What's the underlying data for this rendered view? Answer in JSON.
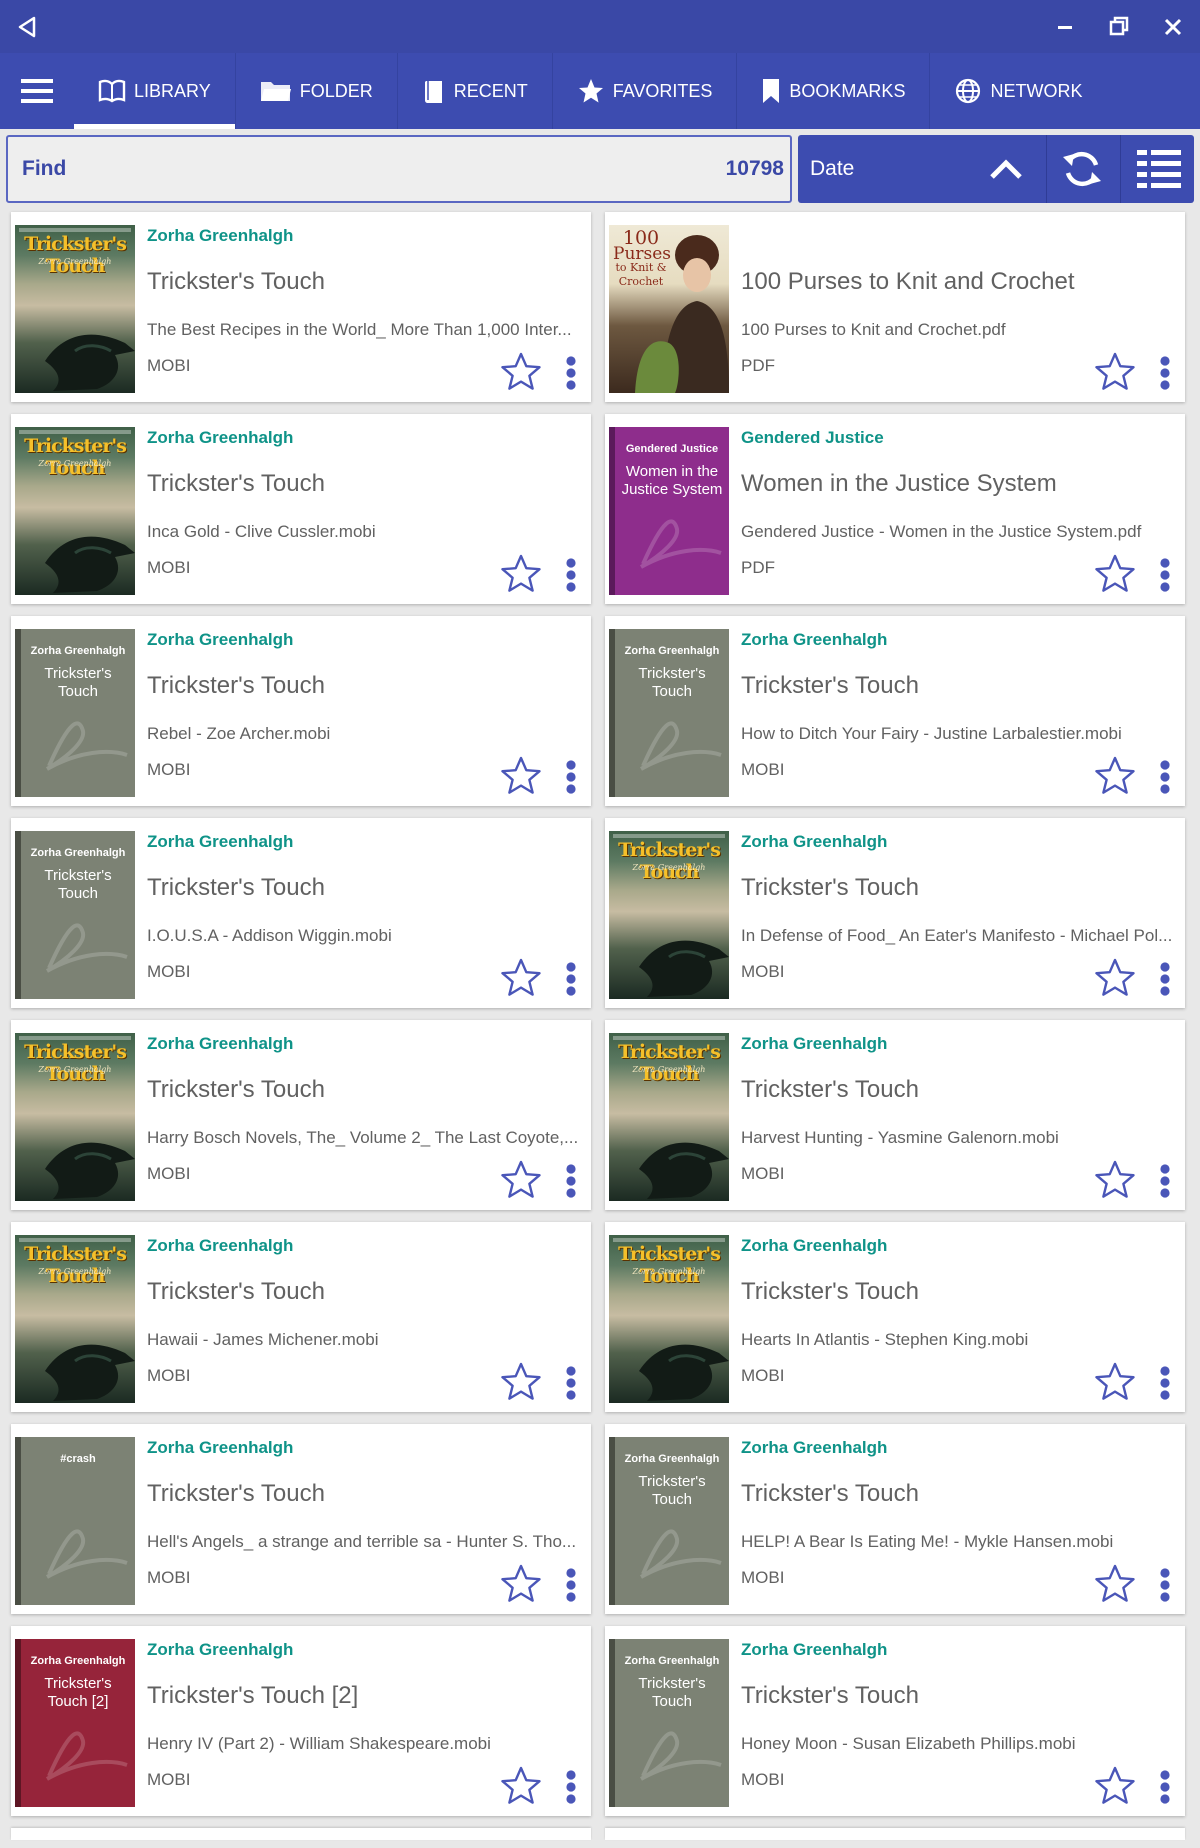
{
  "nav": {
    "tabs": [
      {
        "label": "LIBRARY",
        "icon": "book-icon",
        "active": true
      },
      {
        "label": "FOLDER",
        "icon": "folder-icon"
      },
      {
        "label": "RECENT",
        "icon": "recent-icon"
      },
      {
        "label": "FAVORITES",
        "icon": "star-icon"
      },
      {
        "label": "BOOKMARKS",
        "icon": "bookmark-icon"
      },
      {
        "label": "NETWORK",
        "icon": "globe-icon"
      }
    ]
  },
  "toolbar": {
    "find_label": "Find",
    "count": "10798",
    "sort_label": "Date"
  },
  "colors": {
    "bar": "#3a48a6",
    "accent_text": "#0f9388",
    "icon": "#4a56b8"
  },
  "books": [
    {
      "author": "Zorha Greenhalgh",
      "title": "Trickster's Touch",
      "file": "The Best Recipes in the World_ More Than 1,000 Inter...",
      "format": "MOBI",
      "cover": "trick"
    },
    {
      "author": "",
      "title": "100 Purses to Knit and Crochet",
      "file": "100 Purses to Knit and Crochet.pdf",
      "format": "PDF",
      "cover": "photo",
      "cover_lines": [
        "100",
        "Purses",
        "to Knit &",
        "Crochet"
      ]
    },
    {
      "author": "Zorha Greenhalgh",
      "title": "Trickster's Touch",
      "file": "Inca Gold - Clive Cussler.mobi",
      "format": "MOBI",
      "cover": "trick"
    },
    {
      "author": "Gendered Justice",
      "title": "Women in the Justice System",
      "file": "Gendered Justice - Women in the Justice System.pdf",
      "format": "PDF",
      "cover": "purple",
      "cover_top": "Gendered Justice",
      "cover_mid": "Women in the Justice System"
    },
    {
      "author": "Zorha Greenhalgh",
      "title": "Trickster's Touch",
      "file": "Rebel - Zoe Archer.mobi",
      "format": "MOBI",
      "cover": "grey",
      "cover_top": "Zorha Greenhalgh",
      "cover_mid": "Trickster's Touch"
    },
    {
      "author": "Zorha Greenhalgh",
      "title": "Trickster's Touch",
      "file": "How to Ditch Your Fairy - Justine Larbalestier.mobi",
      "format": "MOBI",
      "cover": "grey",
      "cover_top": "Zorha Greenhalgh",
      "cover_mid": "Trickster's Touch"
    },
    {
      "author": "Zorha Greenhalgh",
      "title": "Trickster's Touch",
      "file": "I.O.U.S.A - Addison Wiggin.mobi",
      "format": "MOBI",
      "cover": "grey",
      "cover_top": "Zorha Greenhalgh",
      "cover_mid": "Trickster's Touch"
    },
    {
      "author": "Zorha Greenhalgh",
      "title": "Trickster's Touch",
      "file": "In Defense of Food_ An Eater's Manifesto - Michael Pol...",
      "format": "MOBI",
      "cover": "trick"
    },
    {
      "author": "Zorha Greenhalgh",
      "title": "Trickster's Touch",
      "file": "Harry Bosch Novels, The_ Volume 2_ The Last Coyote,...",
      "format": "MOBI",
      "cover": "trick"
    },
    {
      "author": "Zorha Greenhalgh",
      "title": "Trickster's Touch",
      "file": "Harvest Hunting - Yasmine Galenorn.mobi",
      "format": "MOBI",
      "cover": "trick"
    },
    {
      "author": "Zorha Greenhalgh",
      "title": "Trickster's Touch",
      "file": "Hawaii - James Michener.mobi",
      "format": "MOBI",
      "cover": "trick"
    },
    {
      "author": "Zorha Greenhalgh",
      "title": "Trickster's Touch",
      "file": "Hearts In Atlantis - Stephen King.mobi",
      "format": "MOBI",
      "cover": "trick"
    },
    {
      "author": "Zorha Greenhalgh",
      "title": "Trickster's Touch",
      "file": "Hell's Angels_ a strange and terrible sa - Hunter S. Tho...",
      "format": "MOBI",
      "cover": "grey",
      "cover_top": "#crash",
      "cover_mid": ""
    },
    {
      "author": "Zorha Greenhalgh",
      "title": "Trickster's Touch",
      "file": "HELP! A Bear Is Eating Me! - Mykle Hansen.mobi",
      "format": "MOBI",
      "cover": "grey",
      "cover_top": "Zorha Greenhalgh",
      "cover_mid": "Trickster's Touch"
    },
    {
      "author": "Zorha Greenhalgh",
      "title": "Trickster's Touch [2]",
      "file": "Henry IV (Part 2) - William Shakespeare.mobi",
      "format": "MOBI",
      "cover": "red",
      "cover_top": "Zorha Greenhalgh",
      "cover_mid": "Trickster's Touch [2]"
    },
    {
      "author": "Zorha Greenhalgh",
      "title": "Trickster's Touch",
      "file": "Honey Moon - Susan Elizabeth Phillips.mobi",
      "format": "MOBI",
      "cover": "grey",
      "cover_top": "Zorha Greenhalgh",
      "cover_mid": "Trickster's Touch"
    }
  ],
  "trick_cover": {
    "title": "Trickster's Touch",
    "author": "Zorra Greenhalgh"
  }
}
